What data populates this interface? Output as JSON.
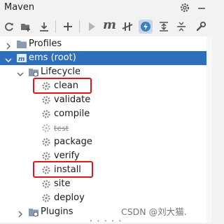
{
  "panel": {
    "title": "Maven",
    "icons": [
      "gear-icon",
      "minimize-icon"
    ]
  },
  "toolbar": {
    "buttons": [
      {
        "name": "reload-icon"
      },
      {
        "name": "add-folder-icon"
      },
      {
        "name": "download-icon"
      },
      {
        "name": "add-icon"
      },
      {
        "name": "run-icon"
      },
      {
        "name": "execute-goal-icon",
        "label": "m"
      },
      {
        "name": "skip-tests-icon"
      },
      {
        "name": "offline-mode-icon",
        "active": true
      },
      {
        "name": "expand-all-icon"
      },
      {
        "name": "collapse-all-icon"
      },
      {
        "name": "settings-wrench-icon"
      }
    ]
  },
  "tree": {
    "profiles": "Profiles",
    "project": "ems (root)",
    "lifecycle": "Lifecycle",
    "goals": [
      "clean",
      "validate",
      "compile",
      "test",
      "package",
      "verify",
      "install",
      "site",
      "deploy"
    ],
    "plugins": "Plugins"
  },
  "watermark": "CSDN @刘大猫.",
  "colors": {
    "selection": "#2e6fbd",
    "highlight_box": "#e3151b",
    "folder": "#8a9bb0",
    "gear": "#8c8c8c"
  }
}
